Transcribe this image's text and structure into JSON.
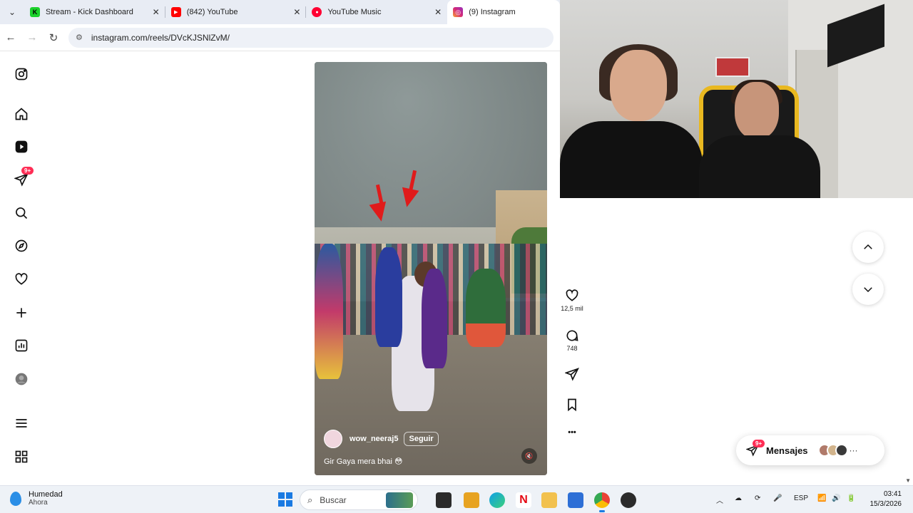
{
  "browser": {
    "tabs": [
      {
        "title": "Stream - Kick Dashboard",
        "icon": "kick-icon",
        "color": "#1bd12b",
        "glyph": "K"
      },
      {
        "title": "(842) YouTube",
        "icon": "youtube-icon",
        "color": "#ff0000",
        "glyph": "▶"
      },
      {
        "title": "YouTube Music",
        "icon": "youtube-music-icon",
        "color": "#ff0033",
        "glyph": "●"
      },
      {
        "title": "(9) Instagram",
        "icon": "instagram-icon",
        "color": "#d62976",
        "glyph": "◎"
      }
    ],
    "close_glyph": "✕",
    "url": "instagram.com/reels/DVcKJSNlZvM/"
  },
  "sidebar": {
    "notification_badge": "9+",
    "items": [
      "instagram-logo",
      "home",
      "reels",
      "messages",
      "search",
      "explore",
      "notifications",
      "create",
      "dashboard",
      "profile",
      "more",
      "also-from-meta"
    ]
  },
  "reel": {
    "username": "wow_neeraj5",
    "follow_label": "Seguir",
    "caption": "Gir Gaya mera bhai 😳",
    "mute_glyph": "🔇"
  },
  "actions": {
    "likes": "12,5 mil",
    "comments": "748",
    "more_glyph": "•••"
  },
  "messages": {
    "label": "Mensajes",
    "badge": "9+",
    "more_glyph": "···"
  },
  "taskbar": {
    "weather_title": "Humedad",
    "weather_sub": "Ahora",
    "search_placeholder": "Buscar",
    "lang": "ESP",
    "time": "03:41",
    "date": "15/3/2026"
  },
  "colors": {
    "accent": "#1a7ae2",
    "badge": "#ff2d55",
    "arrow_red": "#e01b1b"
  }
}
